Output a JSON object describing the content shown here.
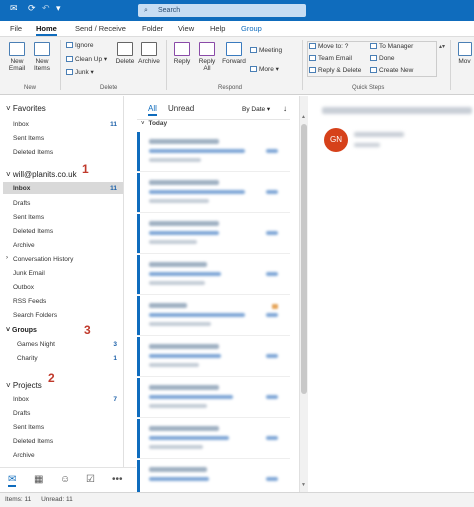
{
  "titlebar": {
    "search_placeholder": "Search"
  },
  "menu": {
    "items": [
      "File",
      "Home",
      "Send / Receive",
      "Folder",
      "View",
      "Help",
      "Group"
    ]
  },
  "ribbon": {
    "new_email": "New Email",
    "new_items": "New Items",
    "ignore": "Ignore",
    "clean_up": "Clean Up",
    "junk": "Junk",
    "delete": "Delete",
    "archive": "Archive",
    "reply": "Reply",
    "reply_all": "Reply All",
    "forward": "Forward",
    "meeting": "Meeting",
    "more": "More",
    "quick_steps": [
      "Move to: ?",
      "Team Email",
      "Reply & Delete",
      "To Manager",
      "Done",
      "Create New"
    ],
    "move": "Mov",
    "groups": {
      "new": "New",
      "delete": "Delete",
      "respond": "Respond",
      "quick_steps": "Quick Steps"
    }
  },
  "folders": {
    "favorites": {
      "title": "Favorites",
      "items": [
        {
          "name": "Inbox",
          "count": "11"
        },
        {
          "name": "Sent Items",
          "count": ""
        },
        {
          "name": "Deleted Items",
          "count": ""
        }
      ]
    },
    "account": {
      "title": "will@planits.co.uk",
      "items": [
        {
          "name": "Inbox",
          "count": "11"
        },
        {
          "name": "Drafts",
          "count": ""
        },
        {
          "name": "Sent Items",
          "count": ""
        },
        {
          "name": "Deleted Items",
          "count": ""
        },
        {
          "name": "Archive",
          "count": ""
        },
        {
          "name": "Conversation History",
          "count": ""
        },
        {
          "name": "Junk Email",
          "count": ""
        },
        {
          "name": "Outbox",
          "count": ""
        },
        {
          "name": "RSS Feeds",
          "count": ""
        },
        {
          "name": "Search Folders",
          "count": ""
        }
      ]
    },
    "groups": {
      "title": "Groups",
      "items": [
        {
          "name": "Games Night",
          "count": "3"
        },
        {
          "name": "Charity",
          "count": "1"
        }
      ]
    },
    "projects": {
      "title": "Projects",
      "items": [
        {
          "name": "Inbox",
          "count": "7"
        },
        {
          "name": "Drafts",
          "count": ""
        },
        {
          "name": "Sent Items",
          "count": ""
        },
        {
          "name": "Deleted Items",
          "count": ""
        },
        {
          "name": "Archive",
          "count": ""
        }
      ]
    },
    "annotations": [
      "1",
      "2",
      "3"
    ]
  },
  "maillist": {
    "tab_all": "All",
    "tab_unread": "Unread",
    "sort": "By Date",
    "sort_dir": "↓",
    "section": "Today"
  },
  "status": {
    "items": "Items: 11",
    "unread": "Unread: 11"
  },
  "reading": {
    "avatar_initials": "GN"
  },
  "colors": {
    "accent": "#0f6cbd",
    "avatar": "#d6411a",
    "annotation": "#c0392b"
  }
}
